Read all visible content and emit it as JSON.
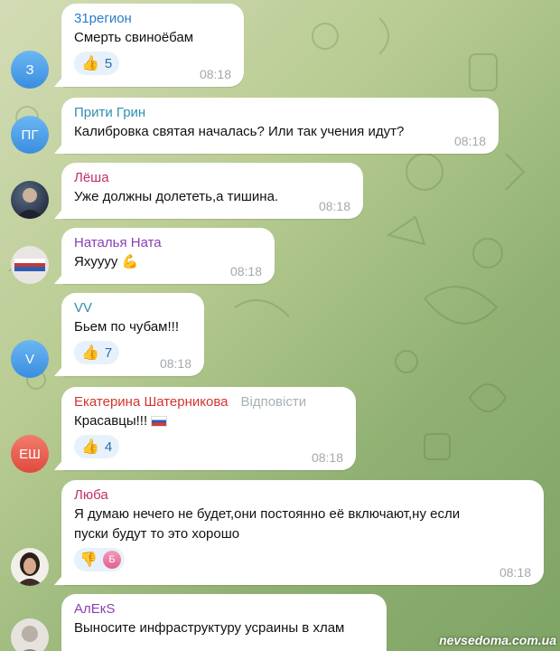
{
  "colors": {
    "name_blue": "#2b7cc7",
    "name_magenta": "#c0306a",
    "name_purple": "#8a3fb5",
    "name_red": "#d0362f",
    "name_teal": "#2f8eb0"
  },
  "messages": [
    {
      "author": "31регион",
      "initials": "З",
      "text": "Смерть свиноёбам",
      "time": "08:18",
      "reaction": {
        "icon": "thumbs-up-icon",
        "count": "5"
      }
    },
    {
      "author": "Прити Грин",
      "initials": "ПГ",
      "text": "Калибровка святая началась? Или так учения идут?",
      "time": "08:18"
    },
    {
      "author": "Лёша",
      "text": "Уже должны долететь,а тишина.",
      "time": "08:18"
    },
    {
      "author": "Наталья Ната",
      "text": "Яхуууу",
      "emoji": "flexed-biceps-icon",
      "time": "08:18"
    },
    {
      "author": "VV",
      "initials": "V",
      "text": "Бьем по чубам!!!",
      "time": "08:18",
      "reaction": {
        "icon": "thumbs-up-icon",
        "count": "7"
      }
    },
    {
      "author": "Екатерина Шатерникова",
      "reply_label": "Відповісти",
      "initials": "ЕШ",
      "text": "Красавцы!!!",
      "emoji": "russia-flag-icon",
      "time": "08:18",
      "reaction": {
        "icon": "thumbs-up-icon",
        "count": "4"
      }
    },
    {
      "author": "Люба",
      "lines": [
        "Я думаю нечего не будет,они постоянно её включают,ну если",
        "пуски будут то это хорошо"
      ],
      "time": "08:18",
      "reaction": {
        "icon": "thumbs-down-icon",
        "avatar_letter": "Б"
      }
    },
    {
      "author": "АлЕкS",
      "text": "Выносите инфраструктуру усраины в хлам"
    }
  ],
  "watermark": "nevsedoma.com.ua"
}
